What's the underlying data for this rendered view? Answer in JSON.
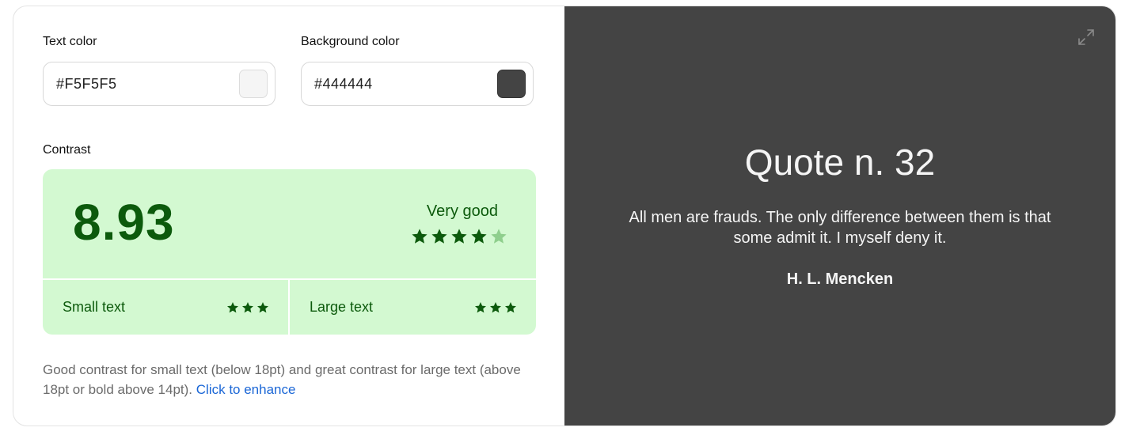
{
  "text_color": {
    "label": "Text color",
    "value": "#F5F5F5",
    "swatch": "#F5F5F5"
  },
  "background_color": {
    "label": "Background color",
    "value": "#444444",
    "swatch": "#444444"
  },
  "contrast": {
    "label": "Contrast",
    "ratio": "8.93",
    "rating": "Very good",
    "rating_stars": 4,
    "rating_stars_max": 5,
    "small_text": {
      "label": "Small text",
      "stars": 3
    },
    "large_text": {
      "label": "Large text",
      "stars": 3
    }
  },
  "note": {
    "text": "Good contrast for small text (below 18pt) and great contrast for large text (above 18pt or bold above 14pt).",
    "link": "Click to enhance"
  },
  "preview": {
    "title": "Quote n. 32",
    "quote": "All men are frauds. The only difference between them is that some admit it. I myself deny it.",
    "author": "H. L. Mencken",
    "expand_icon": "expand-icon"
  },
  "colors": {
    "success_bg": "#d3f9d1",
    "success_fg": "#0c5a0c",
    "star_inactive": "#8fcf8d",
    "link": "#1a66d6"
  }
}
